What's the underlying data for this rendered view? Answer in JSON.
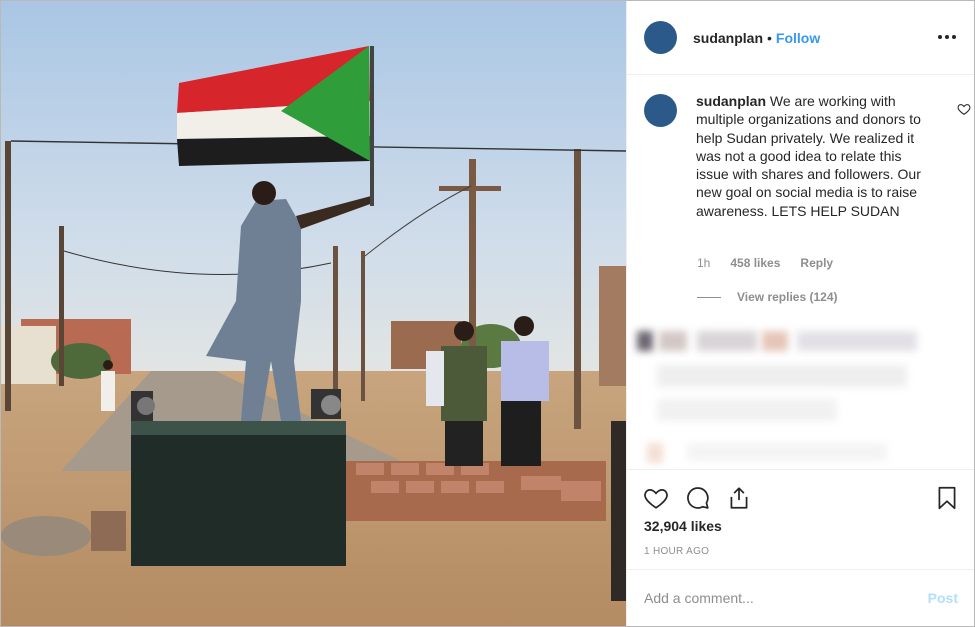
{
  "post": {
    "username": "sudanplan",
    "separator": "•",
    "follow_label": "Follow",
    "more_icon": "more-horizontal-icon"
  },
  "caption": {
    "username": "sudanplan",
    "text": "We are working with multiple organizations and donors to help Sudan privately. We realized it was not a good idea to relate this issue with shares and followers. Our new goal on social media is to raise awareness. LETS HELP SUDAN",
    "age": "1h",
    "likes": "458 likes",
    "reply_label": "Reply",
    "view_replies": "View replies (124)"
  },
  "actions": {
    "like_icon": "heart-icon",
    "comment_icon": "comment-icon",
    "share_icon": "share-icon",
    "save_icon": "bookmark-icon",
    "likes_count": "32,904 likes",
    "timestamp": "1 HOUR AGO"
  },
  "comment_box": {
    "placeholder": "Add a comment...",
    "post_label": "Post"
  },
  "colors": {
    "link": "#3897f0",
    "post_disabled": "#b2dffc",
    "avatar": "#2b5a8a",
    "flag_red": "#d6262b",
    "flag_green": "#2f9e3a"
  }
}
